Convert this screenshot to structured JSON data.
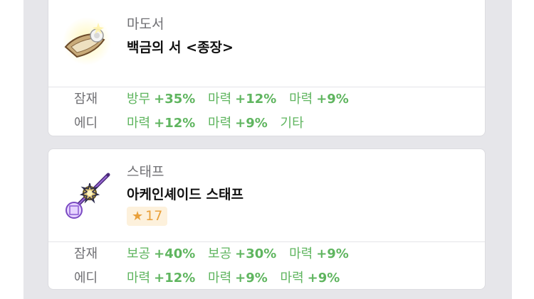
{
  "items": [
    {
      "category": "마도서",
      "name": "백금의 서 <종장>",
      "icon": "scroll-book-icon",
      "rows": [
        {
          "label": "잠재",
          "options": [
            {
              "stat": "방무",
              "value": "+35%"
            },
            {
              "stat": "마력",
              "value": "+12%"
            },
            {
              "stat": "마력",
              "value": "+9%"
            }
          ]
        },
        {
          "label": "에디",
          "options": [
            {
              "stat": "마력",
              "value": "+12%"
            },
            {
              "stat": "마력",
              "value": "+9%"
            },
            {
              "stat": "기타",
              "value": ""
            }
          ]
        }
      ]
    },
    {
      "category": "스태프",
      "name": "아케인셰이드 스태프",
      "icon": "staff-icon",
      "star_force": "17",
      "rows": [
        {
          "label": "잠재",
          "options": [
            {
              "stat": "보공",
              "value": "+40%"
            },
            {
              "stat": "보공",
              "value": "+30%"
            },
            {
              "stat": "마력",
              "value": "+9%"
            }
          ]
        },
        {
          "label": "에디",
          "options": [
            {
              "stat": "마력",
              "value": "+12%"
            },
            {
              "stat": "마력",
              "value": "+9%"
            },
            {
              "stat": "마력",
              "value": "+9%"
            }
          ]
        }
      ]
    }
  ],
  "colors": {
    "option_green": "#5fb55f",
    "star_gold": "#e9a03a",
    "panel_bg": "#e6e6ea"
  }
}
